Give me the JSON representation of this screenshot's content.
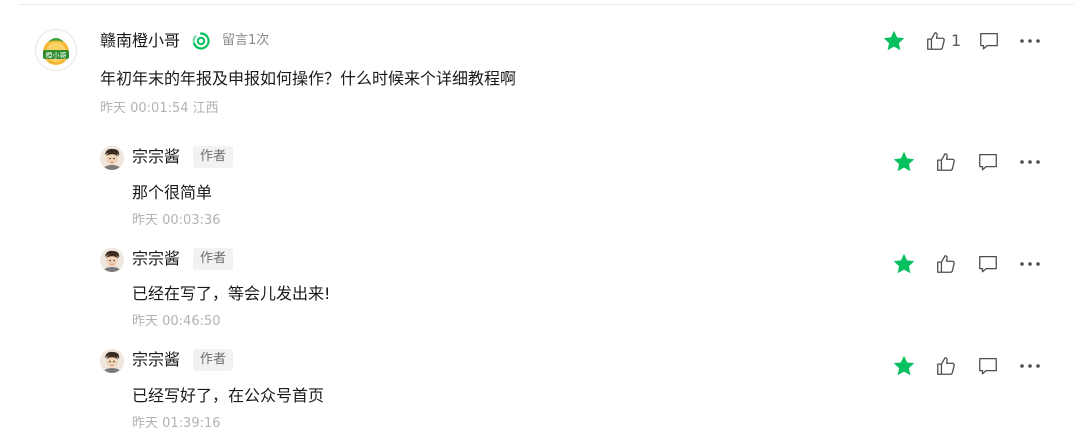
{
  "comment": {
    "author": "赣南橙小哥",
    "badge": "留言1次",
    "text": "年初年末的年报及申报如何操作？什么时候来个详细教程啊",
    "meta": "昨天 00:01:54 江西",
    "likes": "1",
    "avatar_label": "橙小哥"
  },
  "replies": [
    {
      "author": "宗宗酱",
      "tag": "作者",
      "text": "那个很简单",
      "meta": "昨天 00:03:36"
    },
    {
      "author": "宗宗酱",
      "tag": "作者",
      "text": "已经在写了，等会儿发出来!",
      "meta": "昨天 00:46:50"
    },
    {
      "author": "宗宗酱",
      "tag": "作者",
      "text": "已经写好了，在公众号首页",
      "meta": "昨天 01:39:16"
    }
  ],
  "icons": {
    "star": "star-icon",
    "like": "thumbs-up-icon",
    "reply": "comment-icon",
    "more": "more-icon",
    "verified": "verified-icon"
  },
  "colors": {
    "star": "#07c160",
    "verified": "#07c160",
    "icon_gray": "#4d4d4d",
    "meta_gray": "#b2b2b2"
  }
}
